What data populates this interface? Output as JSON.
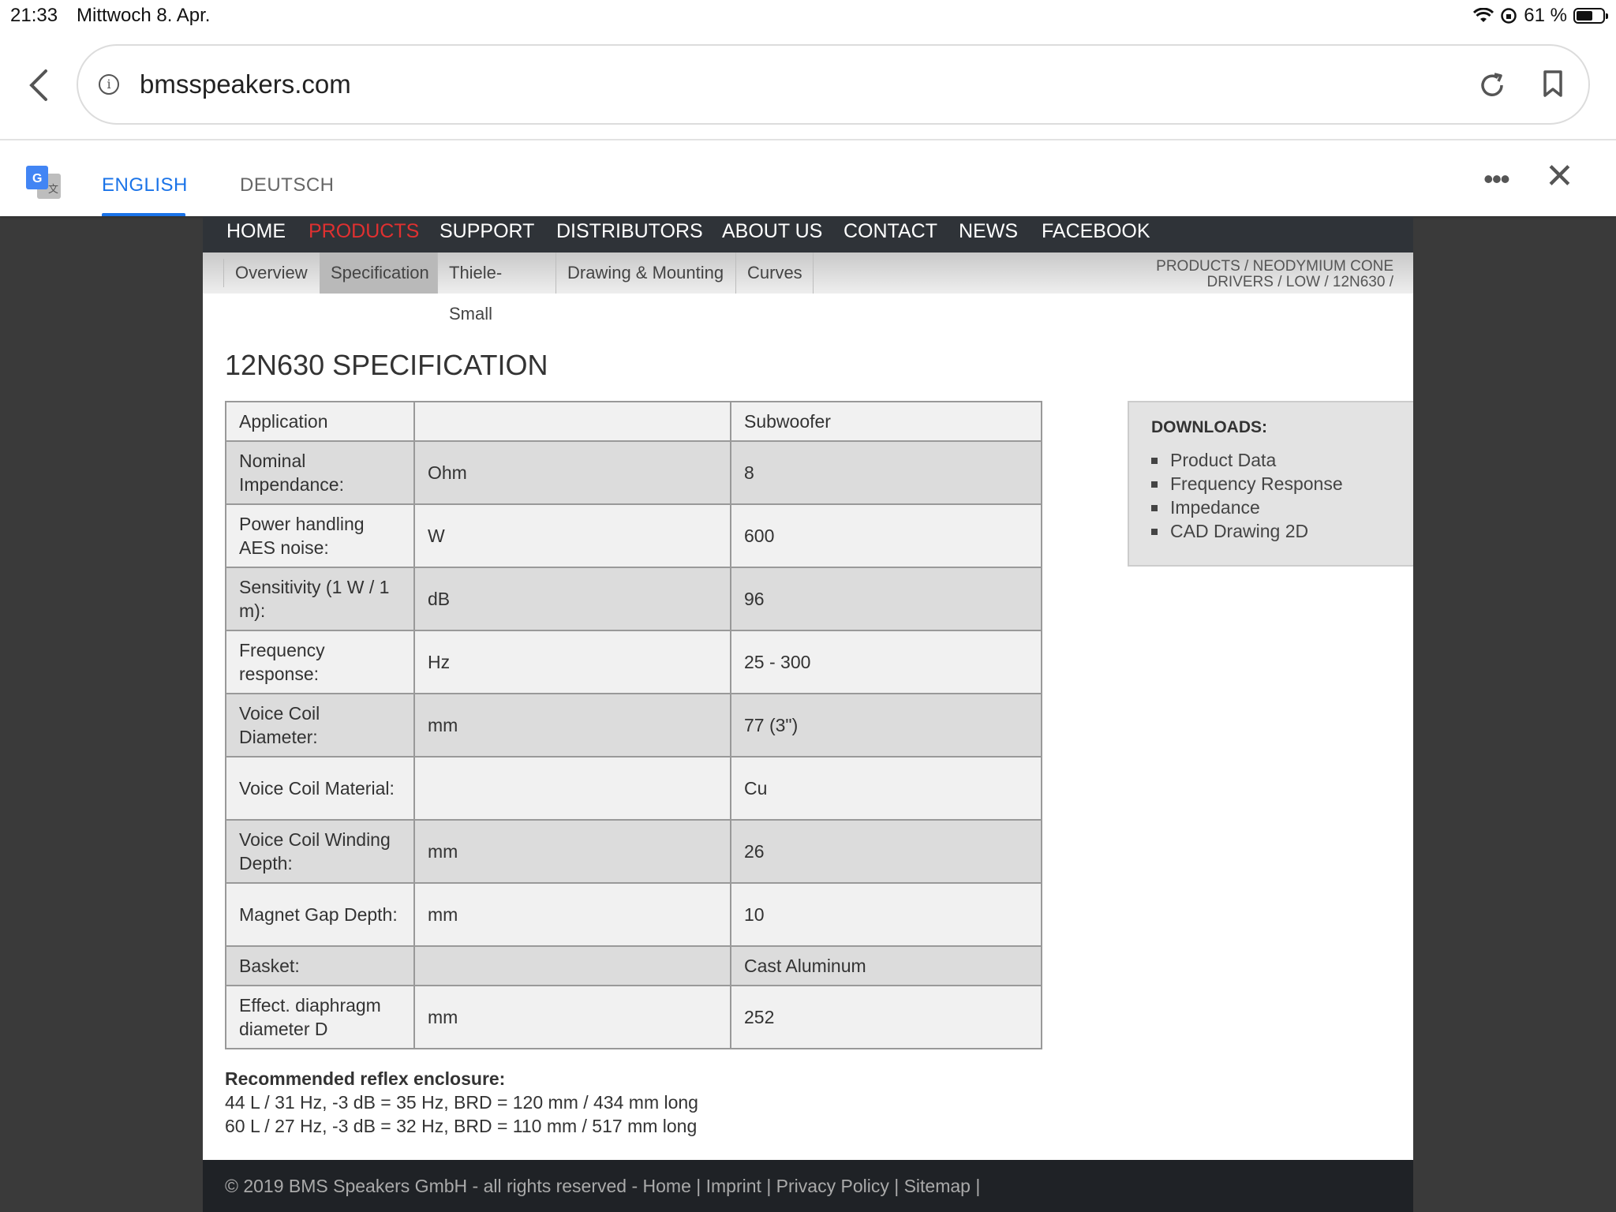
{
  "status_bar": {
    "time": "21:33",
    "date": "Mittwoch 8. Apr.",
    "battery": "61 %",
    "battery_level": 0.61
  },
  "browser": {
    "url": "bmsspeakers.com",
    "icons": [
      "back-icon",
      "info-icon",
      "reload-icon",
      "bookmark-icon"
    ]
  },
  "translate_bar": {
    "tabs": [
      "ENGLISH",
      "DEUTSCH"
    ],
    "active_tab": "ENGLISH",
    "accent_color": "#1a73e8"
  },
  "main_nav": {
    "items": [
      "HOME",
      "PRODUCTS",
      "SUPPORT",
      "DISTRIBUTORS",
      "ABOUT US",
      "CONTACT",
      "NEWS",
      "FACEBOOK"
    ],
    "active_color": "#e03030"
  },
  "sub_nav": {
    "tabs": [
      "Overview",
      "Specification",
      "Thiele-Small",
      "Drawing & Mounting",
      "Curves"
    ],
    "active": "Specification"
  },
  "breadcrumb": {
    "line1": "PRODUCTS / NEODYMIUM CONE",
    "line2": "DRIVERS / LOW / 12N630 /"
  },
  "title": "12N630 SPECIFICATION",
  "spec_table": [
    {
      "param": "Application",
      "unit": "",
      "value": "Subwoofer"
    },
    {
      "param": "Nominal Impendance:",
      "unit": "Ohm",
      "value": "8"
    },
    {
      "param": "Power handling AES noise:",
      "unit": "W",
      "value": "600"
    },
    {
      "param": "Sensitivity (1 W / 1 m):",
      "unit": "dB",
      "value": "96"
    },
    {
      "param": "Frequency response:",
      "unit": "Hz",
      "value": "25 - 300"
    },
    {
      "param": "Voice Coil Diameter:",
      "unit": "mm",
      "value": "77 (3\")"
    },
    {
      "param": "Voice Coil Material:",
      "unit": "",
      "value": "Cu"
    },
    {
      "param": "Voice Coil Winding Depth:",
      "unit": "mm",
      "value": "26"
    },
    {
      "param": "Magnet Gap Depth:",
      "unit": "mm",
      "value": "10"
    },
    {
      "param": "Basket:",
      "unit": "",
      "value": "Cast Aluminum"
    },
    {
      "param": "Effect. diaphragm diameter D",
      "unit": "mm",
      "value": "252"
    }
  ],
  "downloads": {
    "heading": "DOWNLOADS:",
    "items": [
      "Product Data",
      "Frequency Response",
      "Impedance",
      "CAD Drawing 2D"
    ]
  },
  "reflex": {
    "heading": "Recommended reflex enclosure:",
    "line1": "44 L / 31 Hz, -3 dB = 35 Hz, BRD = 120 mm / 434 mm long",
    "line2": "60 L / 27 Hz, -3 dB = 32 Hz, BRD = 110 mm / 517 mm long"
  },
  "footer": {
    "text": "© 2019 BMS Speakers GmbH - all rights reserved - Home | Imprint | Privacy Policy | Sitemap |"
  }
}
